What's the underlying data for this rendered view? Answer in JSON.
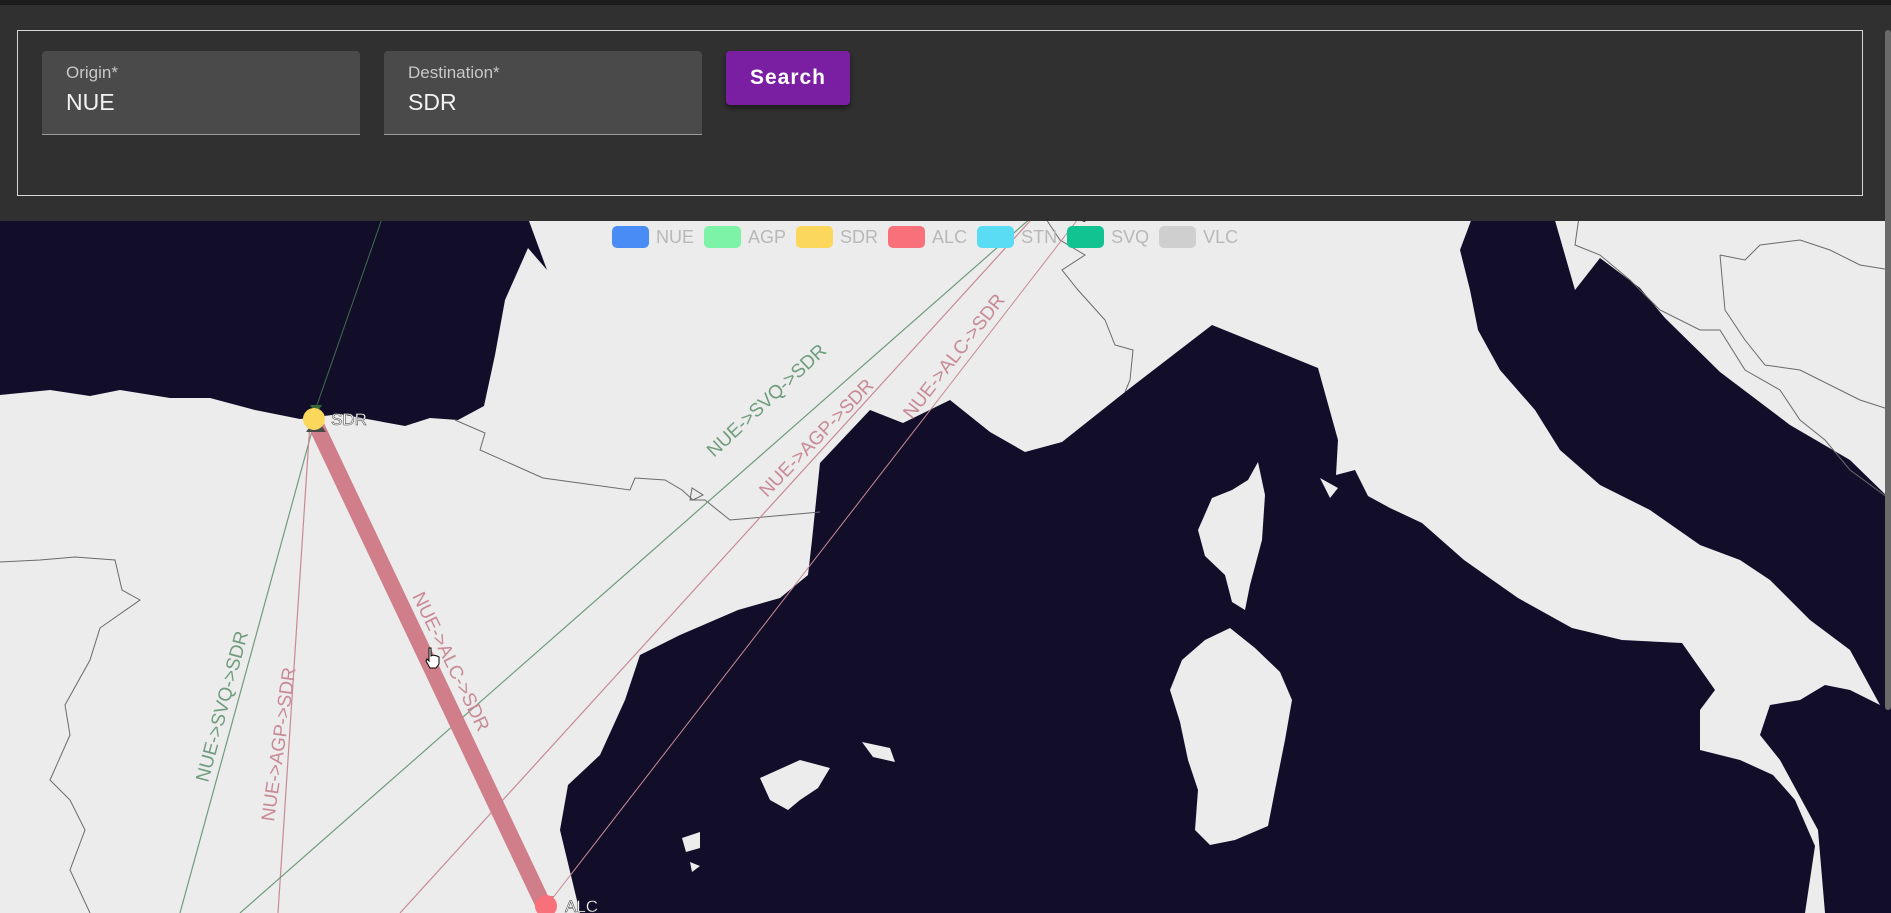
{
  "search": {
    "origin_label": "Origin*",
    "origin_value": "NUE",
    "destination_label": "Destination*",
    "destination_value": "SDR",
    "button_label": "Search"
  },
  "legend": [
    {
      "label": "NUE",
      "color": "#4a8cf6"
    },
    {
      "label": "AGP",
      "color": "#7cf3a6"
    },
    {
      "label": "SDR",
      "color": "#fbd85c"
    },
    {
      "label": "ALC",
      "color": "#f8707a"
    },
    {
      "label": "STN",
      "color": "#5adcf5"
    },
    {
      "label": "SVQ",
      "color": "#11c391"
    },
    {
      "label": "VLC",
      "color": "#cfcfcf"
    }
  ],
  "airports": {
    "sdr": {
      "label": "SDR",
      "color": "#fbd85c"
    },
    "alc": {
      "label": "ALC",
      "color": "#f8707a"
    }
  },
  "routes": [
    {
      "label": "NUE->SVQ->SDR",
      "color": "#6f9c7d"
    },
    {
      "label": "NUE->AGP->SDR",
      "color": "#c88a94"
    },
    {
      "label": "NUE->ALC->SDR",
      "color": "#c88a94"
    }
  ],
  "colors": {
    "sea": "#120e2a",
    "land": "#ececec",
    "topbar": "#303030",
    "accent": "#7b1fa2",
    "route_main": "#d07f8a"
  }
}
